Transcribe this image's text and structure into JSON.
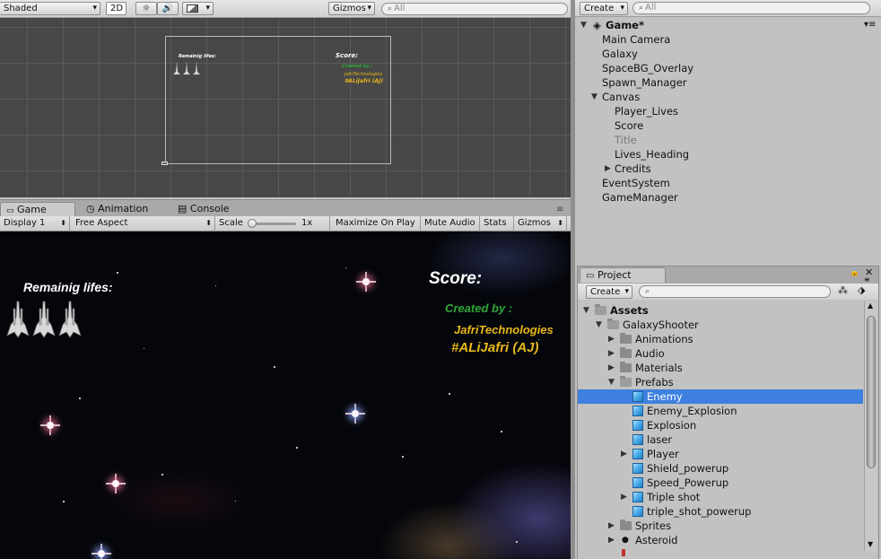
{
  "scene": {
    "shading_mode": "Shaded",
    "mode_2d": "2D",
    "gizmos": "Gizmos",
    "search_placeholder": "All",
    "canvas": {
      "lives_label": "Remainig lifes:",
      "score_label": "Score:",
      "created_by": "Created by :",
      "company": "JafriTechnologies",
      "author": "#ALiJafri (AJ)"
    }
  },
  "game": {
    "tabs": [
      {
        "label": "Game",
        "icon": "game-icon"
      },
      {
        "label": "Animation",
        "icon": "clock-icon"
      },
      {
        "label": "Console",
        "icon": "console-icon"
      }
    ],
    "toolbar": {
      "display": "Display 1",
      "aspect": "Free Aspect",
      "scale_label": "Scale",
      "scale_value": "1x",
      "maximize": "Maximize On Play",
      "mute": "Mute Audio",
      "stats": "Stats",
      "gizmos": "Gizmos"
    },
    "hud": {
      "lives_label": "Remainig lifes:",
      "lives_count": 3,
      "score_label": "Score:",
      "created_by": "Created by :",
      "company": "JafriTechnologies",
      "author": "#ALiJafri (AJ)"
    },
    "colors": {
      "created_by": "#2fa83a",
      "company": "#e8b81a",
      "author": "#e8b81a"
    }
  },
  "hierarchy": {
    "create_label": "Create",
    "search_placeholder": "All",
    "scene_name": "Game*",
    "items": [
      {
        "label": "Main Camera",
        "depth": 0
      },
      {
        "label": "Galaxy",
        "depth": 0
      },
      {
        "label": "SpaceBG_Overlay",
        "depth": 0
      },
      {
        "label": "Spawn_Manager",
        "depth": 0
      },
      {
        "label": "Canvas",
        "depth": 0,
        "expanded": true
      },
      {
        "label": "Player_Lives",
        "depth": 1
      },
      {
        "label": "Score",
        "depth": 1
      },
      {
        "label": "Title",
        "depth": 1,
        "inactive": true
      },
      {
        "label": "Lives_Heading",
        "depth": 1
      },
      {
        "label": "Credits",
        "depth": 1,
        "collapsed": true
      },
      {
        "label": "EventSystem",
        "depth": 0
      },
      {
        "label": "GameManager",
        "depth": 0
      }
    ]
  },
  "project": {
    "tab_label": "Project",
    "create_label": "Create",
    "items": [
      {
        "label": "Assets",
        "type": "folder",
        "depth": 0,
        "expanded": true,
        "bold": true
      },
      {
        "label": "GalaxyShooter",
        "type": "folder",
        "depth": 1,
        "expanded": true
      },
      {
        "label": "Animations",
        "type": "folder",
        "depth": 2,
        "collapsed": true
      },
      {
        "label": "Audio",
        "type": "folder",
        "depth": 2,
        "collapsed": true
      },
      {
        "label": "Materials",
        "type": "folder",
        "depth": 2,
        "collapsed": true
      },
      {
        "label": "Prefabs",
        "type": "folder",
        "depth": 2,
        "expanded": true
      },
      {
        "label": "Enemy",
        "type": "prefab",
        "depth": 3,
        "selected": true
      },
      {
        "label": "Enemy_Explosion",
        "type": "prefab",
        "depth": 3
      },
      {
        "label": "Explosion",
        "type": "prefab",
        "depth": 3
      },
      {
        "label": "laser",
        "type": "prefab",
        "depth": 3
      },
      {
        "label": "Player",
        "type": "prefab",
        "depth": 3,
        "collapsed": true
      },
      {
        "label": "Shield_powerup",
        "type": "prefab",
        "depth": 3
      },
      {
        "label": "Speed_Powerup",
        "type": "prefab",
        "depth": 3
      },
      {
        "label": "Triple shot",
        "type": "prefab",
        "depth": 3,
        "collapsed": true
      },
      {
        "label": "triple_shot_powerup",
        "type": "prefab",
        "depth": 3
      },
      {
        "label": "Sprites",
        "type": "folder",
        "depth": 2,
        "collapsed": true
      },
      {
        "label": "Asteroid",
        "type": "asset",
        "depth": 2,
        "collapsed": true
      }
    ]
  },
  "accent_color": "#3d80df"
}
